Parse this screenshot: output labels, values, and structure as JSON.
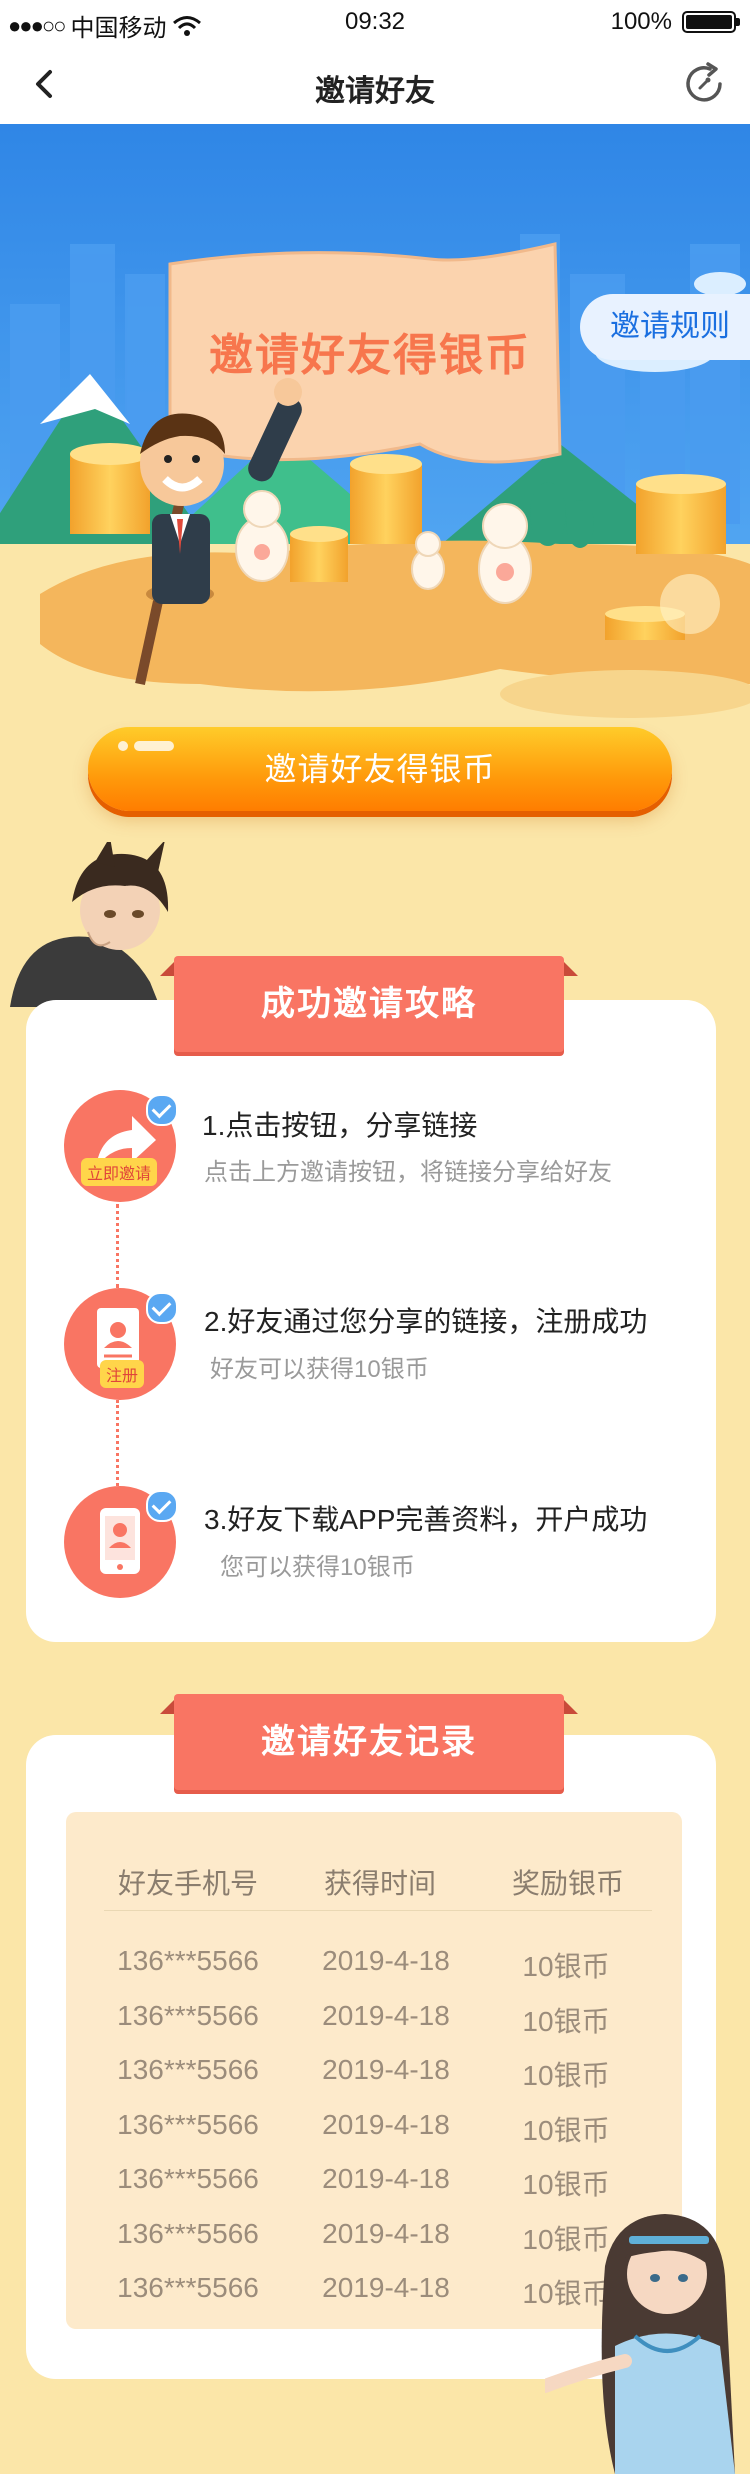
{
  "status_bar": {
    "carrier": "中国移动",
    "time": "09:32",
    "battery": "100%"
  },
  "nav": {
    "title": "邀请好友",
    "back_icon": "chevron-left-icon",
    "refresh_icon": "refresh-icon"
  },
  "banner": {
    "rules_label": "邀请规则",
    "flag_text": "邀请好友得银币"
  },
  "invite_button": {
    "label": "邀请好友得银币"
  },
  "strategy": {
    "title": "成功邀请攻略",
    "steps": [
      {
        "title": "1.点击按钮，分享链接",
        "desc": "点击上方邀请按钮，将链接分享给好友",
        "tag": "立即邀请"
      },
      {
        "title": "2.好友通过您分享的链接，注册成功",
        "desc": "好友可以获得10银币",
        "tag": "注册"
      },
      {
        "title": "3.好友下载APP完善资料，开户成功",
        "desc": "您可以获得10银币"
      }
    ]
  },
  "records": {
    "title": "邀请好友记录",
    "columns": [
      "好友手机号",
      "获得时间",
      "奖励银币"
    ],
    "rows": [
      [
        "136***5566",
        "2019-4-18",
        "10银币"
      ],
      [
        "136***5566",
        "2019-4-18",
        "10银币"
      ],
      [
        "136***5566",
        "2019-4-18",
        "10银币"
      ],
      [
        "136***5566",
        "2019-4-18",
        "10银币"
      ],
      [
        "136***5566",
        "2019-4-18",
        "10银币"
      ],
      [
        "136***5566",
        "2019-4-18",
        "10银币"
      ],
      [
        "136***5566",
        "2019-4-18",
        "10银币"
      ]
    ]
  },
  "colors": {
    "accent": "#f97563",
    "button_orange": "#ff9a0b",
    "page_bg": "#fbe6a8",
    "sky_blue": "#3a8ee8"
  }
}
